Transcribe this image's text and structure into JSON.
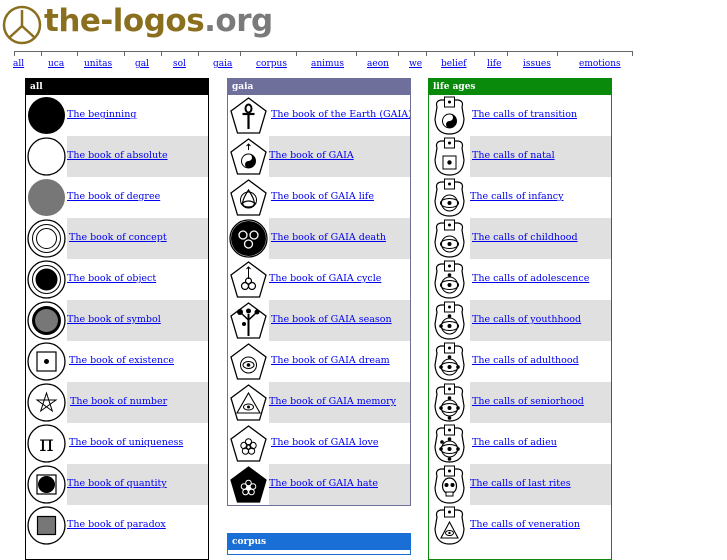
{
  "site": {
    "name": "the-logos",
    "tld": ".org"
  },
  "nav": [
    "all",
    "uca",
    "unitas",
    "gal",
    "sol",
    "gaia",
    "corpus",
    "animus",
    "aeon",
    "we",
    "belief",
    "life",
    "issues",
    "emotions"
  ],
  "panels": {
    "all": {
      "title": "all",
      "color": "#000000",
      "items": [
        {
          "label": "The beginning",
          "icon": "filled-black-circle-icon"
        },
        {
          "label": "The book of absolute",
          "icon": "empty-circle-icon"
        },
        {
          "label": "The book of degree",
          "icon": "gray-circle-icon"
        },
        {
          "label": "The book of concept",
          "icon": "concentric-circles-icon"
        },
        {
          "label": "The book of object",
          "icon": "circle-black-center-icon"
        },
        {
          "label": "The book of symbol",
          "icon": "circle-gray-center-icon"
        },
        {
          "label": "The book of existence",
          "icon": "square-dot-icon"
        },
        {
          "label": "The book of number",
          "icon": "pentagram-icon"
        },
        {
          "label": "The book of uniqueness",
          "icon": "pi-icon"
        },
        {
          "label": "The book of quantity",
          "icon": "square-black-circle-icon"
        },
        {
          "label": "The book of paradox",
          "icon": "gray-square-icon"
        }
      ]
    },
    "gaia": {
      "title": "gaia",
      "color": "#6f6f9c",
      "items": [
        {
          "label": "The book of the Earth (GAIA)",
          "icon": "ankh-icon"
        },
        {
          "label": "The book of GAIA",
          "icon": "yin-yang-icon"
        },
        {
          "label": "The book of GAIA life",
          "icon": "triquetra-icon"
        },
        {
          "label": "The book of GAIA death",
          "icon": "triskele-icon"
        },
        {
          "label": "The book of GAIA cycle",
          "icon": "spiral-icon"
        },
        {
          "label": "The book of GAIA season",
          "icon": "tree-icon"
        },
        {
          "label": "The book of GAIA dream",
          "icon": "eye-icon"
        },
        {
          "label": "The book of GAIA memory",
          "icon": "eye-triangle-icon"
        },
        {
          "label": "The book of GAIA love",
          "icon": "flower-icon"
        },
        {
          "label": "The book of GAIA hate",
          "icon": "black-flower-icon"
        }
      ]
    },
    "corpus": {
      "title": "corpus",
      "color": "#1a6fd6"
    },
    "life": {
      "title": "life ages",
      "color": "#0a8a0a",
      "items": [
        {
          "label": "The calls of transition",
          "icon": "yin-yang-icon"
        },
        {
          "label": "The calls of natal",
          "icon": "square-dot-icon"
        },
        {
          "label": "The calls of infancy",
          "icon": "eye-icon"
        },
        {
          "label": "The calls of childhood",
          "icon": "eye-icon"
        },
        {
          "label": "The calls of adolescence",
          "icon": "eye-icon"
        },
        {
          "label": "The calls of youthhood",
          "icon": "eye-icon"
        },
        {
          "label": "The calls of adulthood",
          "icon": "eye-icon"
        },
        {
          "label": "The calls of seniorhood",
          "icon": "eye-icon"
        },
        {
          "label": "The calls of adieu",
          "icon": "eye-icon"
        },
        {
          "label": "The calls of last rites",
          "icon": "skull-icon"
        },
        {
          "label": "The calls of veneration",
          "icon": "eye-triangle-icon"
        }
      ]
    }
  }
}
